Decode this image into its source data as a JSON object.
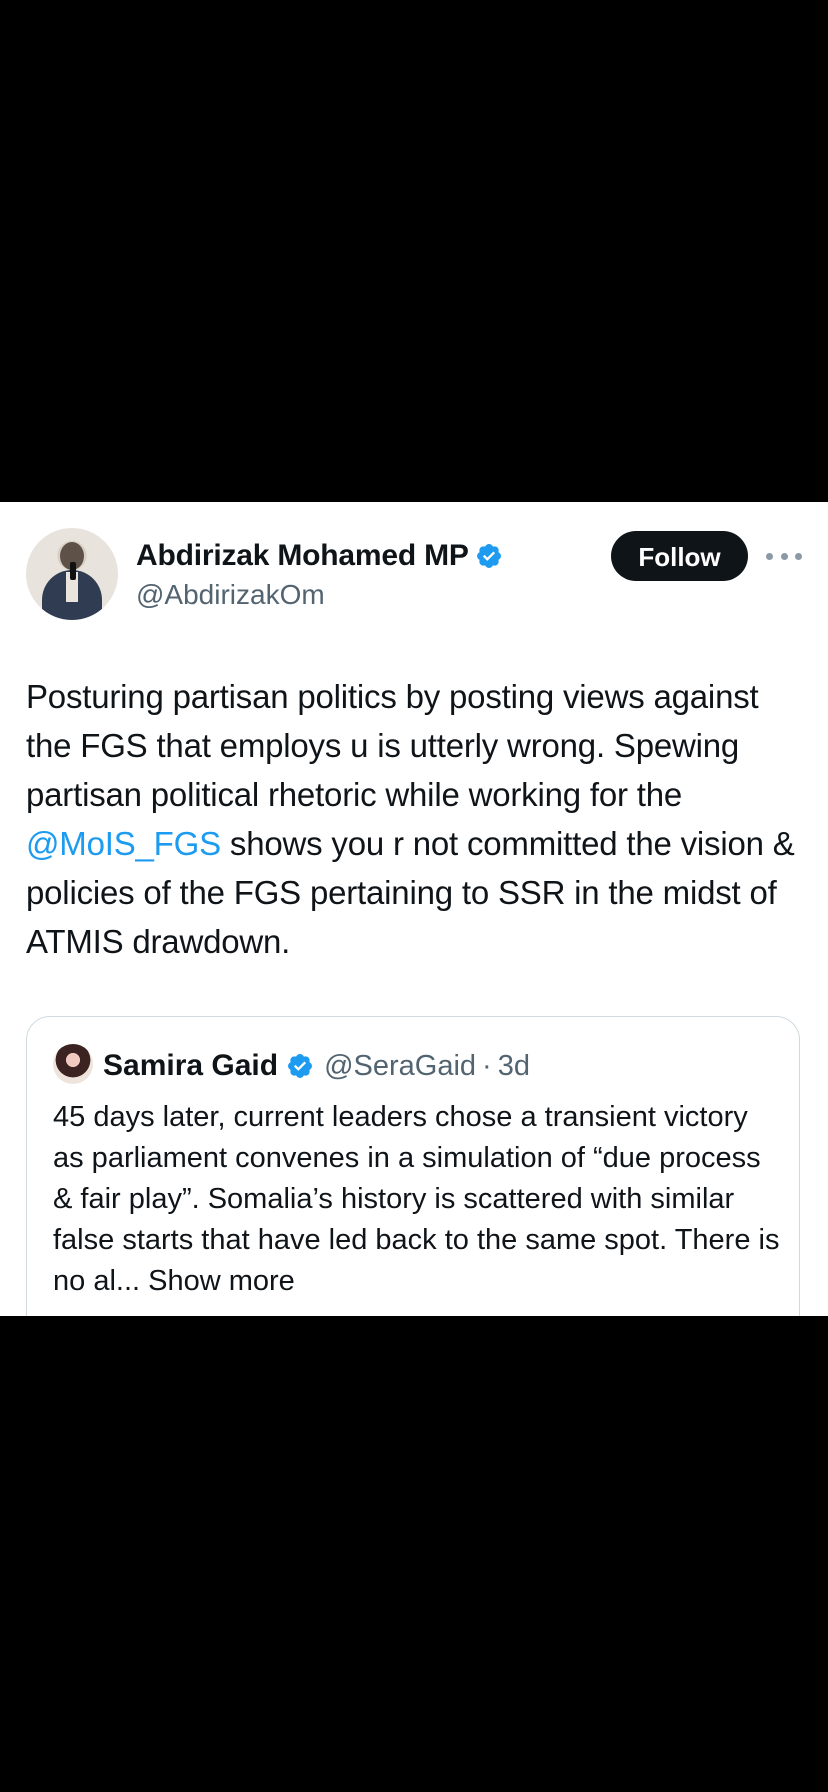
{
  "tweet": {
    "author_name": "Abdirizak Mohamed MP",
    "author_handle": "@AbdirizakOm",
    "follow_label": "Follow",
    "text_before_mention": "Posturing partisan politics by posting views against the FGS that employs u is utterly wrong. Spewing partisan political rhetoric while working for the ",
    "mention": "@MoIS_FGS",
    "text_after_mention": " shows you r not committed the vision & policies of the FGS pertaining to SSR in the midst of ATMIS drawdown."
  },
  "quote": {
    "author_name": "Samira Gaid",
    "author_handle": "@SeraGaid",
    "separator": "·",
    "time": "3d",
    "text": "45 days later, current leaders chose a transient victory as parliament convenes in a simulation of “due process & fair play”. Somalia’s history is scattered with similar false starts that have led back to the same spot. There is no al... Show more"
  },
  "colors": {
    "verified": "#1d9bf0",
    "mention": "#1d9bf0",
    "secondary_text": "#536471",
    "follow_bg": "#0f1419"
  },
  "icons": {
    "verified": "verified-badge-icon",
    "more": "more-dots-icon"
  }
}
